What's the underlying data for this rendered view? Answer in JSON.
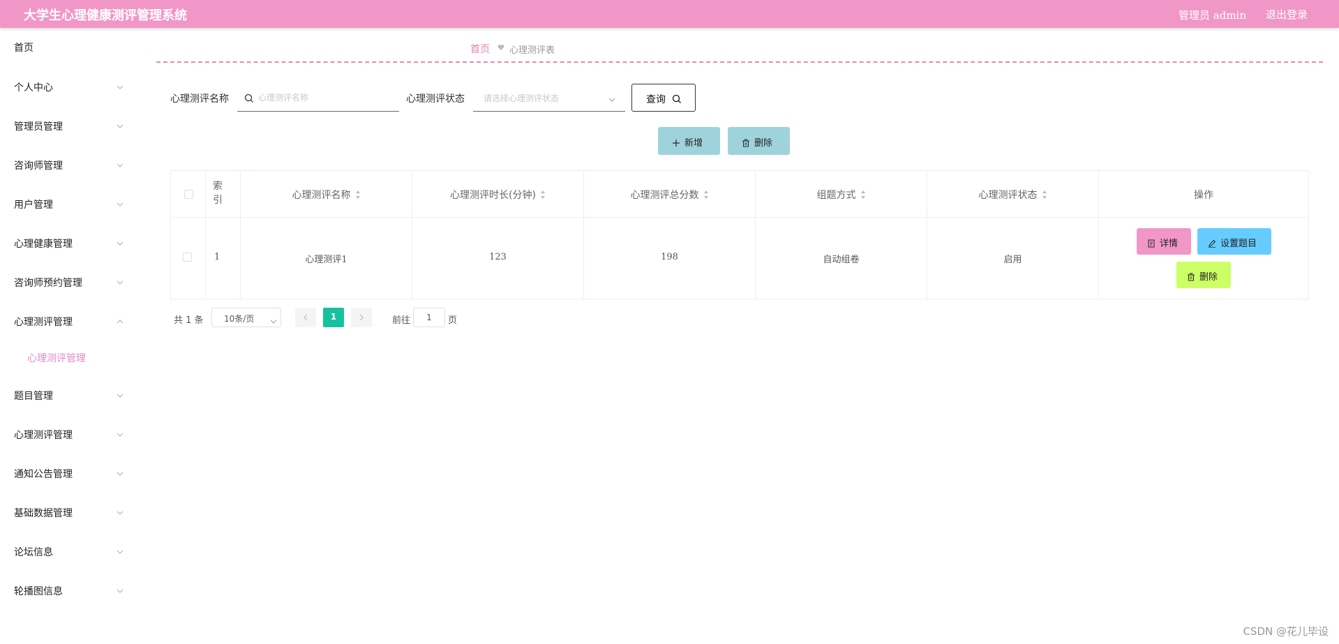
{
  "header": {
    "title": "大学生心理健康测评管理系统",
    "user": "管理员 admin",
    "logout": "退出登录"
  },
  "sidebar": {
    "items": [
      {
        "label": "首页"
      },
      {
        "label": "个人中心"
      },
      {
        "label": "管理员管理"
      },
      {
        "label": "咨询师管理"
      },
      {
        "label": "用户管理"
      },
      {
        "label": "心理健康管理"
      },
      {
        "label": "咨询师预约管理"
      },
      {
        "label": "心理测评管理"
      },
      {
        "label": "心理测评管理"
      },
      {
        "label": "题目管理"
      },
      {
        "label": "心理测评管理"
      },
      {
        "label": "通知公告管理"
      },
      {
        "label": "基础数据管理"
      },
      {
        "label": "论坛信息"
      },
      {
        "label": "轮播图信息"
      }
    ]
  },
  "breadcrumb": {
    "home": "首页",
    "current": "心理测评表"
  },
  "search": {
    "name_label": "心理测评名称",
    "name_placeholder": "心理测评名称",
    "status_label": "心理测评状态",
    "status_placeholder": "请选择心理测评状态",
    "query_label": "查询"
  },
  "actions": {
    "add_label": "新增",
    "delete_label": "删除"
  },
  "colors": {
    "header": "#f197c7",
    "accent_pink": "#e48ac1",
    "action_btn": "#9fd3dc",
    "detail_btn": "#f197c7",
    "setting_btn": "#66ccff",
    "delete_btn": "#ccff66",
    "page_active": "#17c1a0"
  },
  "table": {
    "index_header": "索引",
    "columns": [
      "心理测评名称",
      "心理测评时长(分钟)",
      "心理测评总分数",
      "组题方式",
      "心理测评状态"
    ],
    "op_header": "操作",
    "rows": [
      {
        "index": "1",
        "name": "心理测评1",
        "duration": "123",
        "total": "198",
        "method": "自动组卷",
        "status": "启用"
      }
    ],
    "op_detail": "详情",
    "op_setting": "设置题目",
    "op_delete": "删除"
  },
  "pagination": {
    "total": "共 1 条",
    "page_size": "10条/页",
    "current_page": "1",
    "goto_label": "前往",
    "goto_value": "1",
    "page_suffix": "页"
  },
  "watermark": "CSDN @花儿毕设"
}
